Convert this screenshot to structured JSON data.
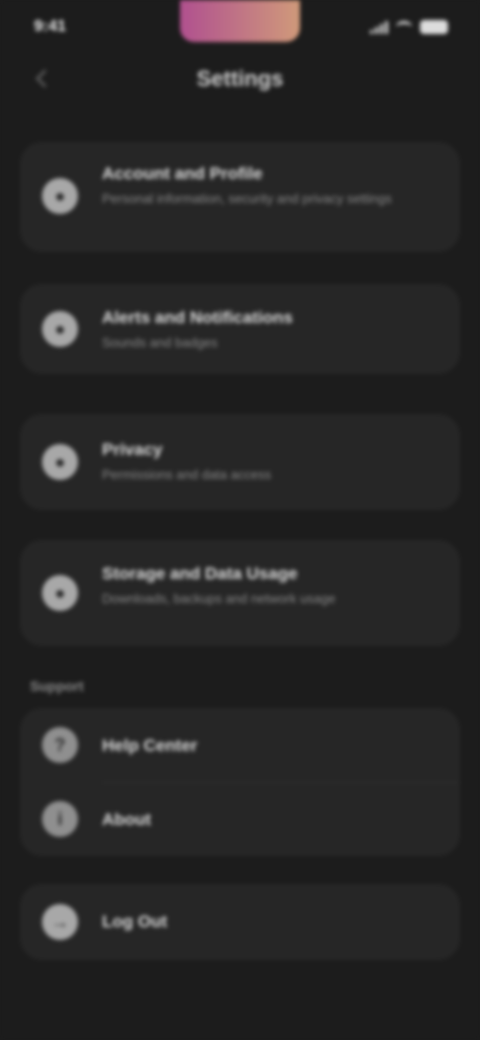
{
  "status_bar": {
    "time": "9:41"
  },
  "profile": {
    "name": "Settings"
  },
  "items": [
    {
      "icon": "person-icon",
      "title": "Account and Profile",
      "subtitle": "Personal information, security and privacy settings"
    },
    {
      "icon": "bell-icon",
      "title": "Alerts and Notifications",
      "subtitle": "Sounds and badges"
    },
    {
      "icon": "shield-icon",
      "title": "Privacy",
      "subtitle": "Permissions and data access"
    },
    {
      "icon": "cloud-icon",
      "title": "Storage and Data Usage",
      "subtitle": "Downloads, backups and network usage"
    }
  ],
  "section": {
    "label": "Support",
    "rows": [
      {
        "icon": "help-icon",
        "title": "Help Center"
      },
      {
        "icon": "info-icon",
        "title": "About"
      }
    ]
  },
  "logout": {
    "icon": "logout-icon",
    "title": "Log Out"
  }
}
